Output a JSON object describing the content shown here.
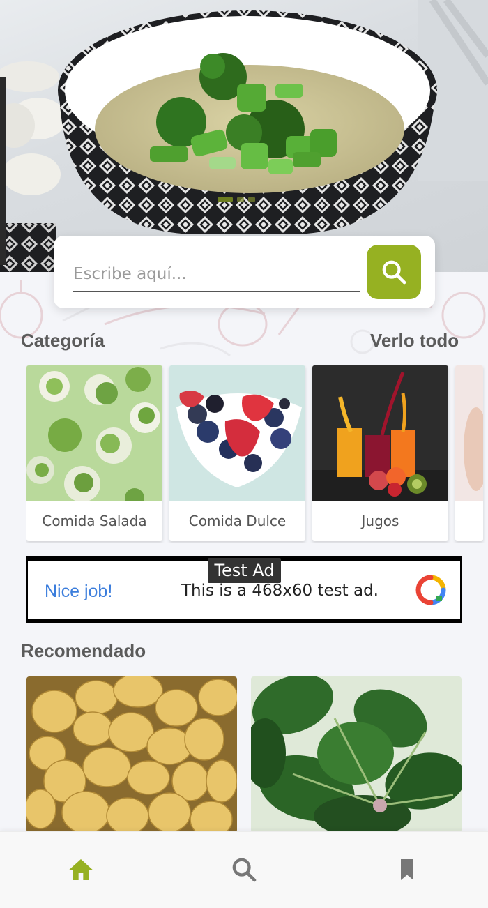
{
  "hero": {
    "slides_count": 3,
    "active_slide": 1
  },
  "search": {
    "placeholder": "Escribe aquí...",
    "value": ""
  },
  "categories": {
    "title": "Categoría",
    "see_all": "Verlo todo",
    "items": [
      {
        "label": "Comida Salada"
      },
      {
        "label": "Comida Dulce"
      },
      {
        "label": "Jugos"
      }
    ]
  },
  "ad": {
    "tag": "Test Ad",
    "headline": "Nice job!",
    "body": "This is a 468x60 test ad."
  },
  "recommended": {
    "title": "Recomendado"
  },
  "nav": {
    "items": [
      "home-icon",
      "search-icon",
      "bookmark-icon"
    ],
    "active_color": "#96b122",
    "inactive_color": "#777777"
  },
  "colors": {
    "accent": "#96b122"
  }
}
